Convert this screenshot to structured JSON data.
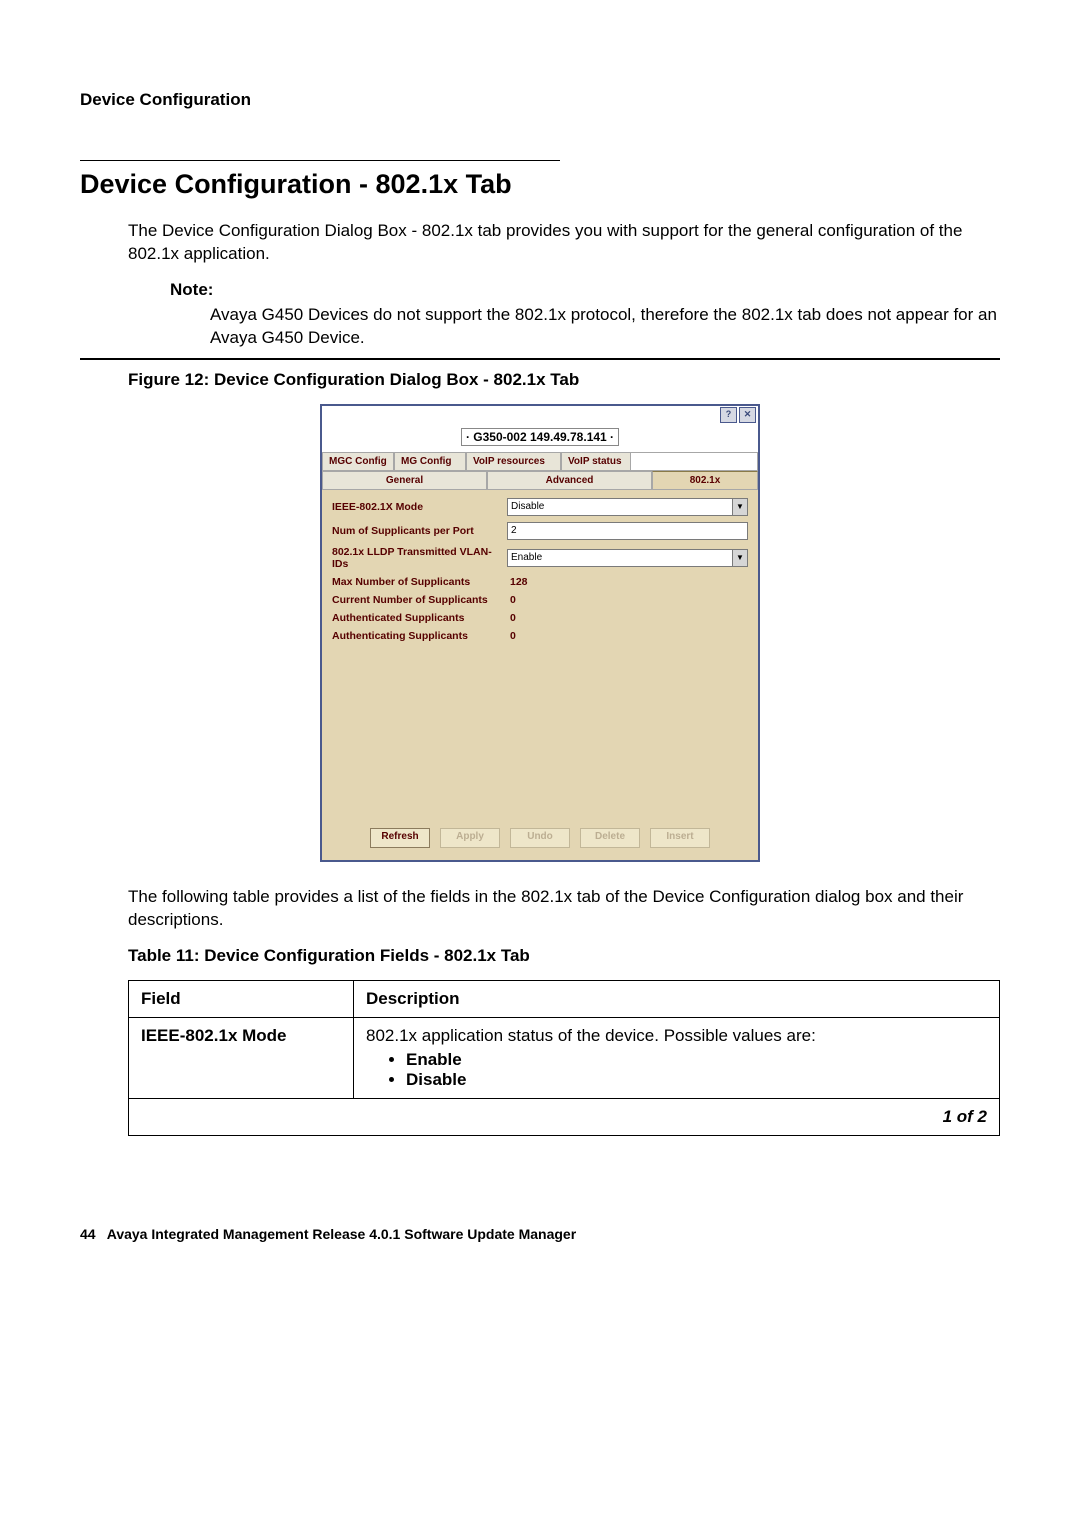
{
  "header": {
    "section": "Device Configuration"
  },
  "title": "Device Configuration - 802.1x Tab",
  "intro": "The Device Configuration Dialog Box - 802.1x tab provides you with support for the general configuration of the 802.1x application.",
  "note": {
    "label": "Note:",
    "text": "Avaya G450 Devices do not support the 802.1x protocol, therefore the 802.1x tab does not appear for an Avaya G450 Device."
  },
  "figure_caption": "Figure 12: Device Configuration Dialog Box - 802.1x Tab",
  "dialog": {
    "device_label": "· G350-002 149.49.78.141 ·",
    "titlebar": {
      "close_glyph": "✕",
      "help_glyph": "?"
    },
    "tabs_row1": [
      "MGC Config",
      "MG Config",
      "VoIP resources",
      "VoIP status"
    ],
    "tabs_row2": [
      "General",
      "Advanced",
      "802.1x"
    ],
    "fields": {
      "mode": {
        "label": "IEEE-802.1X Mode",
        "value": "Disable"
      },
      "num_supp_port": {
        "label": "Num of Supplicants per Port",
        "value": "2"
      },
      "lldp_vlan": {
        "label": "802.1x LLDP Transmitted VLAN-IDs",
        "value": "Enable"
      },
      "max_supp": {
        "label": "Max Number of Supplicants",
        "value": "128"
      },
      "cur_supp": {
        "label": "Current Number of Supplicants",
        "value": "0"
      },
      "authd_supp": {
        "label": "Authenticated Supplicants",
        "value": "0"
      },
      "authing_supp": {
        "label": "Authenticating Supplicants",
        "value": "0"
      }
    },
    "buttons": {
      "refresh": "Refresh",
      "apply": "Apply",
      "undo": "Undo",
      "delete": "Delete",
      "insert": "Insert"
    }
  },
  "post_figure": "The following table provides a list of the fields in the 802.1x tab of the Device Configuration dialog box and their descriptions.",
  "table_caption": "Table 11: Device Configuration Fields - 802.1x Tab",
  "table": {
    "headers": {
      "field": "Field",
      "desc": "Description"
    },
    "rows": [
      {
        "field": "IEEE-802.1x Mode",
        "desc": "802.1x application status of the device. Possible values are:",
        "bullets": [
          "Enable",
          "Disable"
        ]
      }
    ],
    "pagination": "1 of 2"
  },
  "footer": {
    "page": "44",
    "doc": "Avaya Integrated Management Release 4.0.1 Software Update Manager"
  }
}
